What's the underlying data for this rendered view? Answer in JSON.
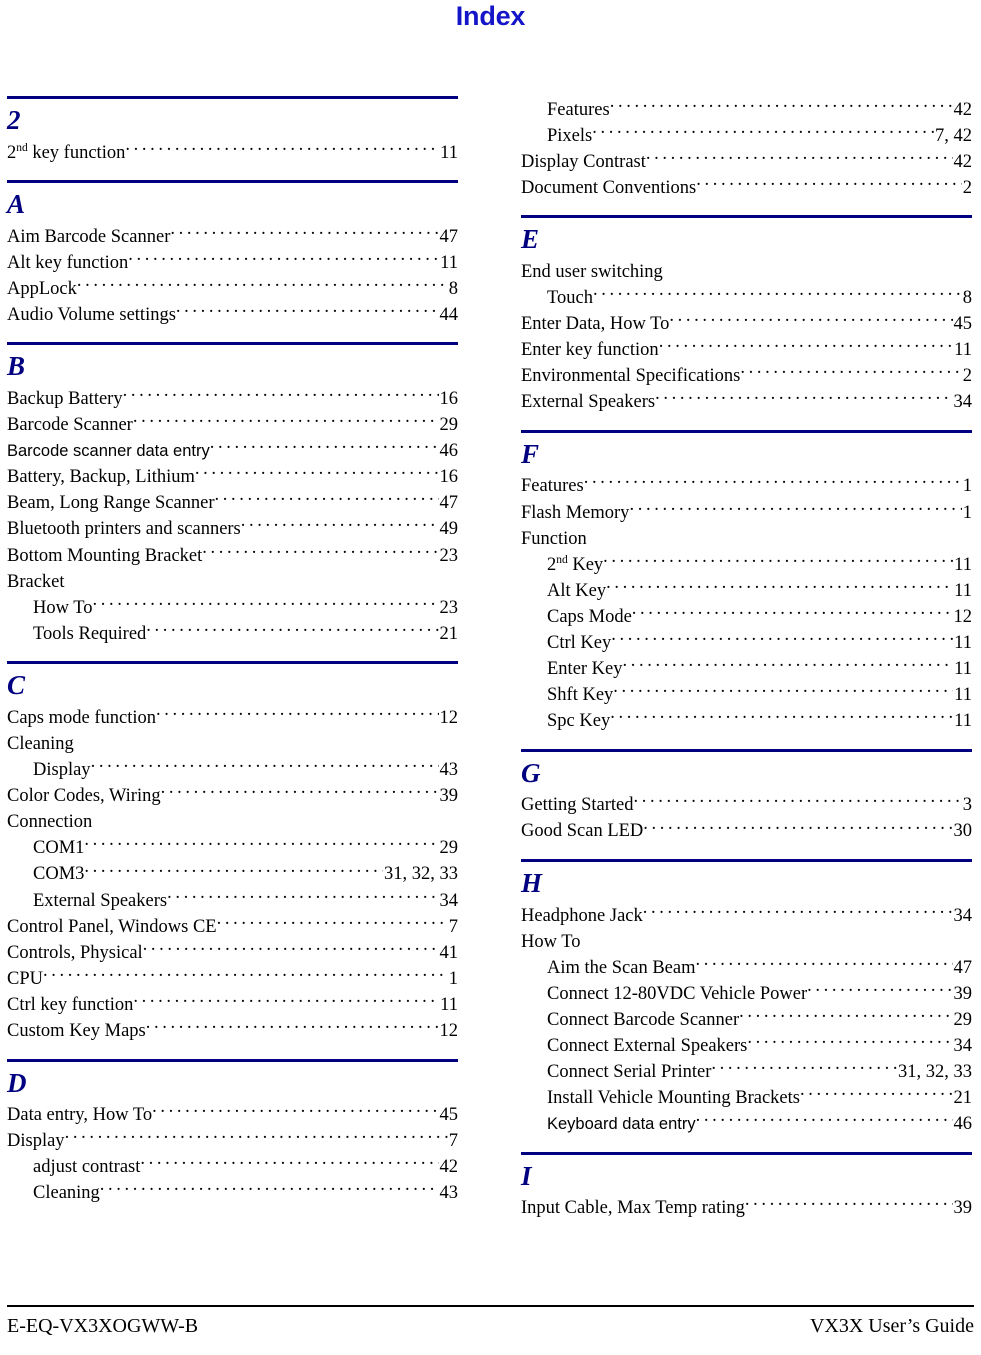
{
  "document": {
    "title": "Index",
    "footer_left": "E-EQ-VX3XOGWW-B",
    "footer_right": "VX3X User’s Guide",
    "accent_color": "#000080",
    "title_color": "#1414c8"
  },
  "columns": [
    {
      "name": "left",
      "sections": [
        {
          "letter": "2",
          "entries": [
            {
              "text": "2nd key function",
              "sup": "nd",
              "base": "2",
              "tail": " key function",
              "page": "11",
              "level": 0,
              "font": "serif"
            }
          ]
        },
        {
          "letter": "A",
          "entries": [
            {
              "text": "Aim Barcode Scanner",
              "page": "47",
              "level": 0,
              "font": "serif"
            },
            {
              "text": "Alt key function",
              "page": "11",
              "level": 0,
              "font": "serif"
            },
            {
              "text": "AppLock",
              "page": "8",
              "level": 0,
              "font": "serif"
            },
            {
              "text": "Audio Volume settings",
              "page": "44",
              "level": 0,
              "font": "serif"
            }
          ]
        },
        {
          "letter": "B",
          "entries": [
            {
              "text": "Backup Battery",
              "page": "16",
              "level": 0,
              "font": "serif"
            },
            {
              "text": "Barcode Scanner",
              "page": "29",
              "level": 0,
              "font": "serif"
            },
            {
              "text": "Barcode scanner data entry",
              "page": "46",
              "level": 0,
              "font": "sans"
            },
            {
              "text": "Battery, Backup, Lithium",
              "page": "16",
              "level": 0,
              "font": "serif"
            },
            {
              "text": "Beam, Long Range Scanner",
              "page": "47",
              "level": 0,
              "font": "serif"
            },
            {
              "text": "Bluetooth printers and scanners",
              "page": "49",
              "level": 0,
              "font": "serif"
            },
            {
              "text": "Bottom Mounting Bracket",
              "page": "23",
              "level": 0,
              "font": "serif"
            },
            {
              "text": "Bracket",
              "page": "",
              "level": 0,
              "font": "serif"
            },
            {
              "text": "How To",
              "page": "23",
              "level": 1,
              "font": "serif"
            },
            {
              "text": "Tools Required",
              "page": "21",
              "level": 1,
              "font": "serif"
            }
          ]
        },
        {
          "letter": "C",
          "entries": [
            {
              "text": "Caps mode function",
              "page": "12",
              "level": 0,
              "font": "serif"
            },
            {
              "text": "Cleaning",
              "page": "",
              "level": 0,
              "font": "serif"
            },
            {
              "text": "Display",
              "page": "43",
              "level": 1,
              "font": "serif"
            },
            {
              "text": "Color Codes, Wiring",
              "page": "39",
              "level": 0,
              "font": "serif"
            },
            {
              "text": "Connection",
              "page": "",
              "level": 0,
              "font": "serif"
            },
            {
              "text": "COM1",
              "page": "29",
              "level": 1,
              "font": "serif"
            },
            {
              "text": "COM3",
              "page": "31, 32, 33",
              "level": 1,
              "font": "serif"
            },
            {
              "text": "External Speakers",
              "page": "34",
              "level": 1,
              "font": "serif"
            },
            {
              "text": "Control Panel, Windows CE",
              "page": "7",
              "level": 0,
              "font": "serif"
            },
            {
              "text": "Controls, Physical",
              "page": "41",
              "level": 0,
              "font": "serif"
            },
            {
              "text": "CPU",
              "page": "1",
              "level": 0,
              "font": "serif"
            },
            {
              "text": "Ctrl key function",
              "page": "11",
              "level": 0,
              "font": "serif"
            },
            {
              "text": "Custom Key Maps",
              "page": "12",
              "level": 0,
              "font": "serif"
            }
          ]
        },
        {
          "letter": "D",
          "entries": [
            {
              "text": "Data entry, How To",
              "page": "45",
              "level": 0,
              "font": "serif"
            },
            {
              "text": "Display",
              "page": "7",
              "level": 0,
              "font": "serif"
            },
            {
              "text": "adjust contrast",
              "page": "42",
              "level": 1,
              "font": "serif"
            },
            {
              "text": "Cleaning",
              "page": "43",
              "level": 1,
              "font": "serif"
            }
          ]
        }
      ]
    },
    {
      "name": "right",
      "continued_entries": [
        {
          "text": "Features",
          "page": "42",
          "level": 1,
          "font": "serif"
        },
        {
          "text": "Pixels",
          "page": "7, 42",
          "level": 1,
          "font": "serif"
        },
        {
          "text": "Display Contrast",
          "page": "42",
          "level": 0,
          "font": "serif"
        },
        {
          "text": "Document Conventions",
          "page": "2",
          "level": 0,
          "font": "serif"
        }
      ],
      "sections": [
        {
          "letter": "E",
          "entries": [
            {
              "text": "End user switching",
              "page": "",
              "level": 0,
              "font": "serif"
            },
            {
              "text": "Touch",
              "page": "8",
              "level": 1,
              "font": "serif"
            },
            {
              "text": "Enter Data, How To",
              "page": "45",
              "level": 0,
              "font": "serif"
            },
            {
              "text": "Enter key function",
              "page": "11",
              "level": 0,
              "font": "serif"
            },
            {
              "text": "Environmental Specifications",
              "page": "2",
              "level": 0,
              "font": "serif"
            },
            {
              "text": "External Speakers",
              "page": "34",
              "level": 0,
              "font": "serif"
            }
          ]
        },
        {
          "letter": "F",
          "entries": [
            {
              "text": "Features",
              "page": "1",
              "level": 0,
              "font": "serif"
            },
            {
              "text": "Flash Memory",
              "page": "1",
              "level": 0,
              "font": "serif"
            },
            {
              "text": "Function",
              "page": "",
              "level": 0,
              "font": "serif"
            },
            {
              "text": "2nd Key",
              "sup": "nd",
              "base": "2",
              "tail": " Key",
              "page": "11",
              "level": 1,
              "font": "serif"
            },
            {
              "text": "Alt Key",
              "page": "11",
              "level": 1,
              "font": "serif"
            },
            {
              "text": "Caps Mode",
              "page": "12",
              "level": 1,
              "font": "serif"
            },
            {
              "text": "Ctrl Key",
              "page": "11",
              "level": 1,
              "font": "serif"
            },
            {
              "text": "Enter Key",
              "page": "11",
              "level": 1,
              "font": "serif"
            },
            {
              "text": "Shft Key",
              "page": "11",
              "level": 1,
              "font": "serif"
            },
            {
              "text": "Spc Key",
              "page": "11",
              "level": 1,
              "font": "serif"
            }
          ]
        },
        {
          "letter": "G",
          "entries": [
            {
              "text": "Getting Started",
              "page": "3",
              "level": 0,
              "font": "serif"
            },
            {
              "text": "Good Scan LED",
              "page": "30",
              "level": 0,
              "font": "serif"
            }
          ]
        },
        {
          "letter": "H",
          "entries": [
            {
              "text": "Headphone Jack",
              "page": "34",
              "level": 0,
              "font": "serif"
            },
            {
              "text": "How To",
              "page": "",
              "level": 0,
              "font": "serif"
            },
            {
              "text": "Aim the Scan Beam",
              "page": "47",
              "level": 1,
              "font": "serif"
            },
            {
              "text": "Connect 12-80VDC Vehicle Power",
              "page": "39",
              "level": 1,
              "font": "serif"
            },
            {
              "text": "Connect Barcode Scanner",
              "page": "29",
              "level": 1,
              "font": "serif"
            },
            {
              "text": "Connect External Speakers",
              "page": "34",
              "level": 1,
              "font": "serif"
            },
            {
              "text": "Connect Serial Printer",
              "page": "31, 32, 33",
              "level": 1,
              "font": "serif"
            },
            {
              "text": "Install Vehicle Mounting Brackets",
              "page": "21",
              "level": 1,
              "font": "serif"
            },
            {
              "text": "Keyboard data entry",
              "page": "46",
              "level": 1,
              "font": "sans"
            }
          ]
        },
        {
          "letter": "I",
          "entries": [
            {
              "text": "Input Cable, Max Temp rating",
              "page": "39",
              "level": 0,
              "font": "serif"
            }
          ]
        }
      ]
    }
  ]
}
